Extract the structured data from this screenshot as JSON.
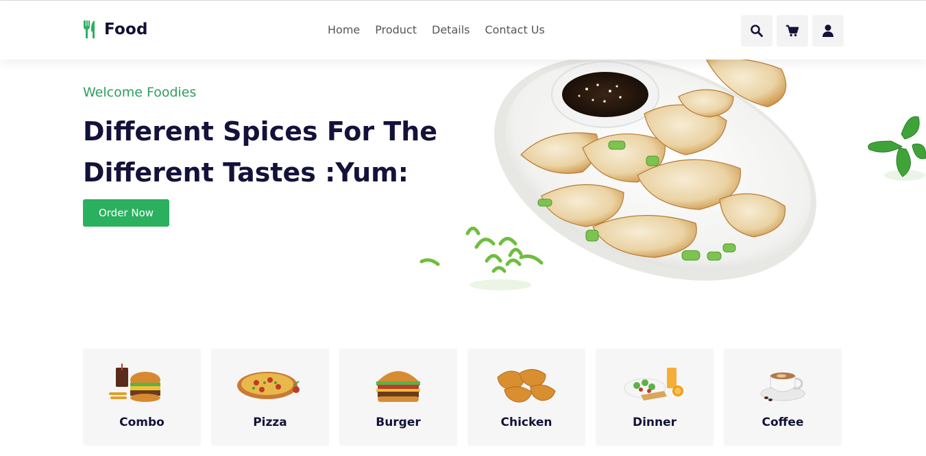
{
  "brand": {
    "name": "Food",
    "icon": "fork-knife-icon",
    "accent": "#2bb060"
  },
  "nav": {
    "items": [
      {
        "label": "Home"
      },
      {
        "label": "Product"
      },
      {
        "label": "Details"
      },
      {
        "label": "Contact Us"
      }
    ]
  },
  "header_actions": [
    {
      "icon": "search-icon"
    },
    {
      "icon": "cart-icon"
    },
    {
      "icon": "user-icon"
    }
  ],
  "hero": {
    "welcome": "Welcome Foodies",
    "headline_line1": "Different Spices For The",
    "headline_line2": "Different Tastes :Yum:",
    "cta": "Order Now"
  },
  "categories": [
    {
      "label": "Combo"
    },
    {
      "label": "Pizza"
    },
    {
      "label": "Burger"
    },
    {
      "label": "Chicken"
    },
    {
      "label": "Dinner"
    },
    {
      "label": "Coffee"
    }
  ]
}
